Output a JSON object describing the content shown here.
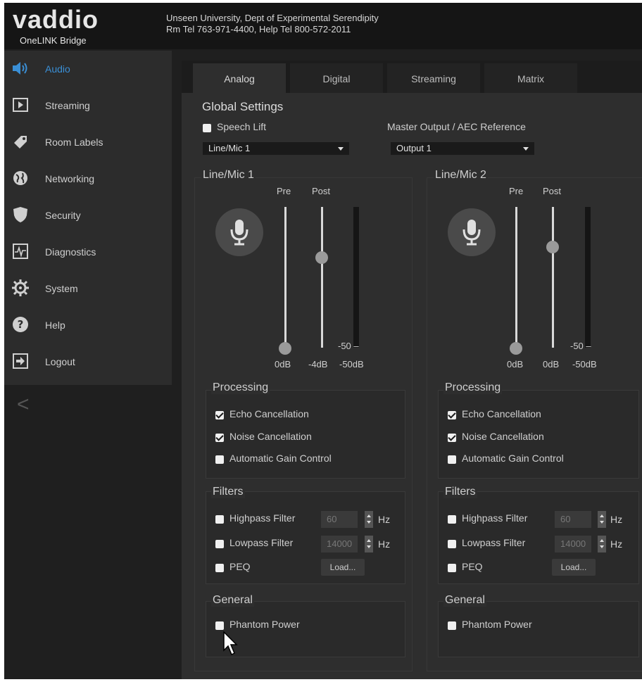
{
  "brand": {
    "name": "vaddio",
    "product": "OneLINK Bridge"
  },
  "header": {
    "org": "Unseen University, Dept of Experimental Serendipity",
    "phones": "Rm Tel 763-971-4400, Help Tel 800-572-2011"
  },
  "sidebar": {
    "items": [
      {
        "label": "Audio",
        "icon": "speaker-icon",
        "active": true
      },
      {
        "label": "Streaming",
        "icon": "play-icon"
      },
      {
        "label": "Room Labels",
        "icon": "tag-icon"
      },
      {
        "label": "Networking",
        "icon": "globe-icon"
      },
      {
        "label": "Security",
        "icon": "shield-icon"
      },
      {
        "label": "Diagnostics",
        "icon": "pulse-icon"
      },
      {
        "label": "System",
        "icon": "gear-icon"
      },
      {
        "label": "Help",
        "icon": "help-icon"
      },
      {
        "label": "Logout",
        "icon": "logout-icon"
      }
    ],
    "collapse": "<"
  },
  "tabs": [
    {
      "label": "Analog",
      "active": true
    },
    {
      "label": "Digital"
    },
    {
      "label": "Streaming"
    },
    {
      "label": "Matrix"
    }
  ],
  "global": {
    "title": "Global Settings",
    "speech_lift_label": "Speech Lift",
    "speech_lift_checked": false,
    "speech_lift_select": "Line/Mic 1",
    "master_label": "Master Output / AEC Reference",
    "master_select": "Output 1"
  },
  "channels": [
    {
      "title": "Line/Mic 1",
      "pre_label": "Pre",
      "post_label": "Post",
      "pre_value": "0dB",
      "post_value": "-4dB",
      "meter_value": "-50dB",
      "meter_mark": "-50",
      "processing": {
        "title": "Processing",
        "echo": {
          "label": "Echo Cancellation",
          "checked": true
        },
        "noise": {
          "label": "Noise Cancellation",
          "checked": true
        },
        "agc": {
          "label": "Automatic Gain Control",
          "checked": false
        }
      },
      "filters": {
        "title": "Filters",
        "highpass": {
          "label": "Highpass Filter",
          "value": "60",
          "unit": "Hz",
          "checked": false
        },
        "lowpass": {
          "label": "Lowpass Filter",
          "value": "14000",
          "unit": "Hz",
          "checked": false
        },
        "peq": {
          "label": "PEQ",
          "checked": false,
          "button": "Load..."
        }
      },
      "general": {
        "title": "General",
        "phantom": {
          "label": "Phantom Power",
          "checked": false
        }
      }
    },
    {
      "title": "Line/Mic 2",
      "pre_label": "Pre",
      "post_label": "Post",
      "pre_value": "0dB",
      "post_value": "0dB",
      "meter_value": "-50dB",
      "meter_mark": "-50",
      "processing": {
        "title": "Processing",
        "echo": {
          "label": "Echo Cancellation",
          "checked": true
        },
        "noise": {
          "label": "Noise Cancellation",
          "checked": true
        },
        "agc": {
          "label": "Automatic Gain Control",
          "checked": false
        }
      },
      "filters": {
        "title": "Filters",
        "highpass": {
          "label": "Highpass Filter",
          "value": "60",
          "unit": "Hz",
          "checked": false
        },
        "lowpass": {
          "label": "Lowpass Filter",
          "value": "14000",
          "unit": "Hz",
          "checked": false
        },
        "peq": {
          "label": "PEQ",
          "checked": false,
          "button": "Load..."
        }
      },
      "general": {
        "title": "General",
        "phantom": {
          "label": "Phantom Power",
          "checked": false
        }
      }
    }
  ],
  "colors": {
    "accent": "#3a8fd6",
    "background": "#1f1f1f"
  }
}
